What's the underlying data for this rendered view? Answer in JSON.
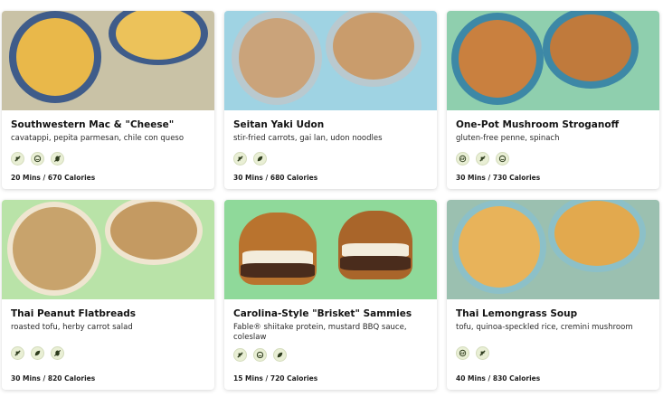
{
  "recipes": [
    {
      "title": "Southwestern Mac & \"Cheese\"",
      "description": "cavatappi, pepita parmesan, chile con queso",
      "footer": "20 Mins / 670 Calories",
      "icons": [
        "gluten-icon",
        "bowl-icon",
        "no-nut-icon"
      ]
    },
    {
      "title": "Seitan Yaki Udon",
      "description": "stir-fried carrots, gai lan, udon noodles",
      "footer": "30 Mins / 680 Calories",
      "icons": [
        "gluten-icon",
        "leaf-icon"
      ]
    },
    {
      "title": "One-Pot Mushroom Stroganoff",
      "description": "gluten-free penne, spinach",
      "footer": "30 Mins / 730 Calories",
      "icons": [
        "gluten-free-icon",
        "gluten-icon",
        "bowl-icon"
      ]
    },
    {
      "title": "Thai Peanut Flatbreads",
      "description": "roasted tofu, herby carrot salad",
      "footer": "30 Mins / 820 Calories",
      "icons": [
        "gluten-icon",
        "leaf-icon",
        "no-nut-icon"
      ]
    },
    {
      "title": "Carolina-Style \"Brisket\" Sammies",
      "description": "Fable® shiitake protein, mustard BBQ sauce, coleslaw",
      "footer": "15 Mins / 720 Calories",
      "icons": [
        "gluten-icon",
        "bowl-icon",
        "leaf-icon"
      ]
    },
    {
      "title": "Thai Lemongrass Soup",
      "description": "tofu, quinoa-speckled rice, cremini mushroom",
      "footer": "40 Mins / 830 Calories",
      "icons": [
        "gluten-free-icon",
        "gluten-icon"
      ]
    }
  ],
  "colors": {
    "icon_fill": "#2f3d1f",
    "icon_bg": "#e9efd5"
  }
}
